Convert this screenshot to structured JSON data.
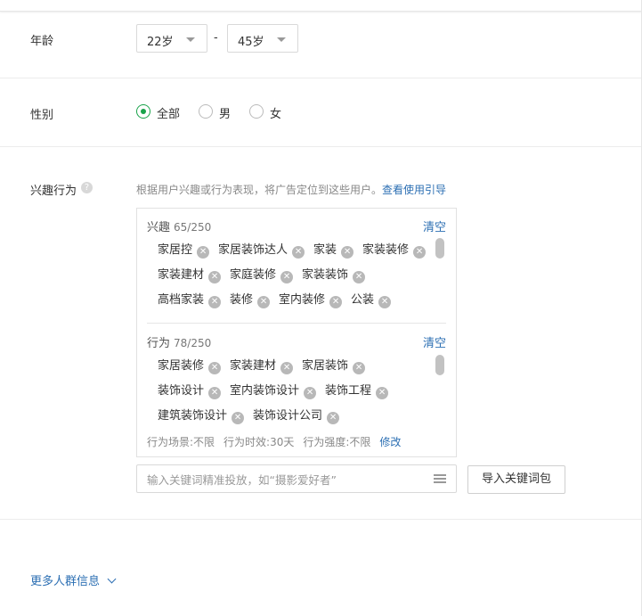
{
  "age": {
    "label": "年龄",
    "min_value": "22岁",
    "separator": "-",
    "max_value": "45岁"
  },
  "gender": {
    "label": "性别",
    "options": [
      "全部",
      "男",
      "女"
    ],
    "selected": "全部"
  },
  "interest": {
    "label": "兴趣行为",
    "hint_text": "根据用户兴趣或行为表现，将广告定位到这些用户。",
    "hint_link": "查看使用引导",
    "interest_section": {
      "title": "兴趣",
      "count": "65/250",
      "clear": "清空",
      "rows": [
        [
          "家居控",
          "家居装饰达人",
          "家装",
          "家装装修"
        ],
        [
          "家装建材",
          "家庭装修",
          "家装装饰"
        ],
        [
          "高档家装",
          "装修",
          "室内装修",
          "公装"
        ]
      ]
    },
    "behavior_section": {
      "title": "行为",
      "count": "78/250",
      "clear": "清空",
      "rows": [
        [
          "家居装修",
          "家装建材",
          "家居装饰"
        ],
        [
          "装饰设计",
          "室内装饰设计",
          "装饰工程"
        ],
        [
          "建筑装饰设计",
          "装饰设计公司"
        ]
      ],
      "scene": "行为场景:不限",
      "timeliness": "行为时效:30天",
      "strength": "行为强度:不限",
      "modify": "修改"
    },
    "keyword_placeholder": "输入关键词精准投放，如“摄影爱好者”",
    "import_button": "导入关键词包"
  },
  "more_link": "更多人群信息",
  "icons": {
    "help": "question-icon",
    "tag_remove": "close-circle-icon",
    "keyword_menu": "menu-icon",
    "more": "chevron-down-icon"
  },
  "colors": {
    "accent_link": "#2c6fb3",
    "radio_selected": "#19a34a"
  }
}
